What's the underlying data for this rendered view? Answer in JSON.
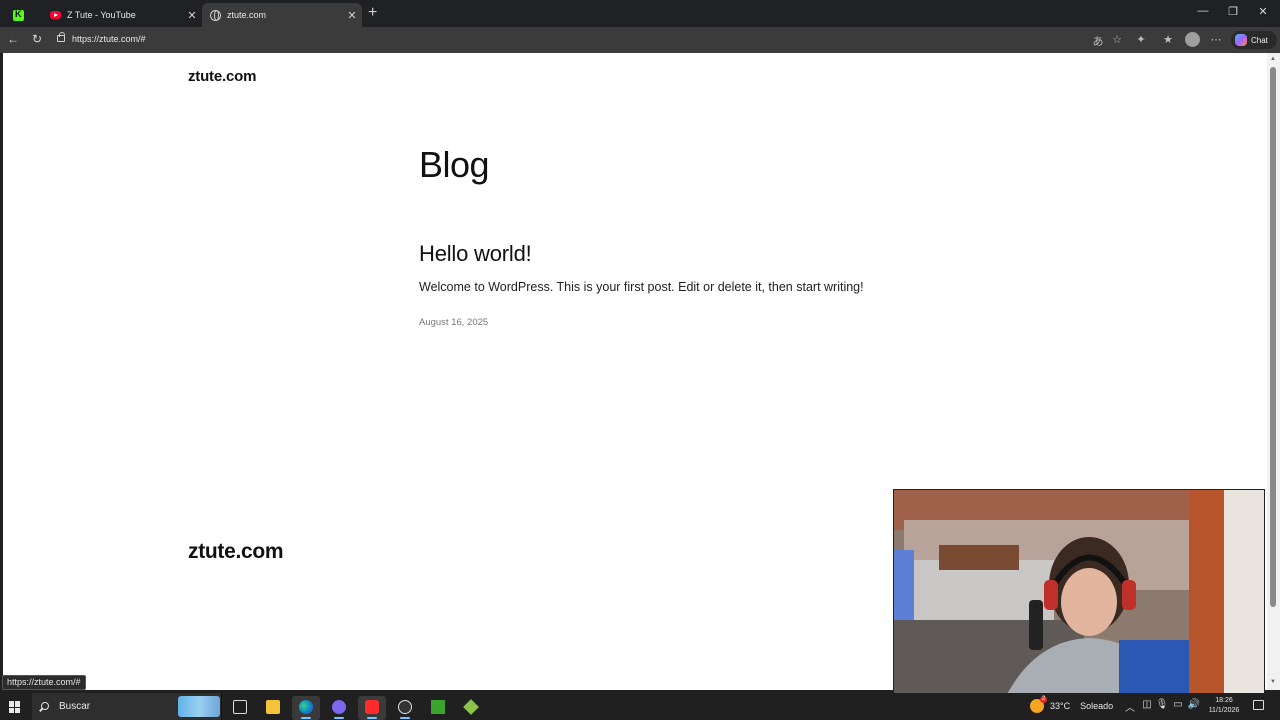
{
  "browser": {
    "tabs": [
      {
        "title": "",
        "icon": "kick-icon"
      },
      {
        "title": "Z Tute - YouTube",
        "icon": "youtube-icon"
      },
      {
        "title": "ztute.com",
        "icon": "globe-icon",
        "active": true
      }
    ],
    "address": "https://ztute.com/#",
    "copilot_label": "Chat"
  },
  "page": {
    "site_title": "ztute.com",
    "heading": "Blog",
    "posts": [
      {
        "title": "Hello world!",
        "excerpt": "Welcome to WordPress. This is your first post. Edit or delete it, then start writing!",
        "date": "August 16, 2025"
      }
    ],
    "footer_title": "ztute.com"
  },
  "status_url": "https://ztute.com/#",
  "taskbar": {
    "search_placeholder": "Buscar",
    "apps": [
      "task-view-icon",
      "file-explorer-icon",
      "edge-icon",
      "app-icon",
      "youtube-icon",
      "obs-icon",
      "minecraft-icon",
      "cube-icon"
    ],
    "weather": {
      "temp": "33°C",
      "condition": "Soleado"
    },
    "time": "18:26",
    "date": "11/1/2026"
  },
  "colors": {
    "chrome_bg": "#202124",
    "toolbar_bg": "#3b3b3b",
    "page_bg": "#ffffff",
    "taskbar_bg": "#202020"
  }
}
